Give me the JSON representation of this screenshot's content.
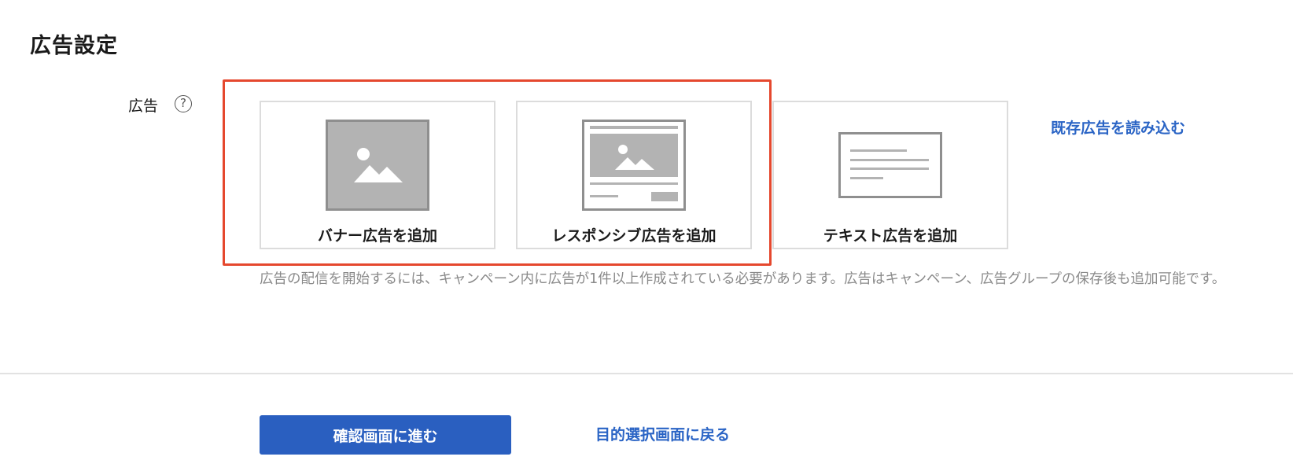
{
  "section": {
    "title": "広告設定"
  },
  "ad_field": {
    "label": "広告",
    "help_icon": "question-circle-icon",
    "help_glyph": "?"
  },
  "ad_cards": [
    {
      "label": "バナー広告を追加",
      "icon": "banner-image-icon"
    },
    {
      "label": "レスポンシブ広告を追加",
      "icon": "responsive-ad-icon"
    },
    {
      "label": "テキスト広告を追加",
      "icon": "text-ad-icon"
    }
  ],
  "load_existing_link": "既存広告を読み込む",
  "note": "広告の配信を開始するには、キャンペーン内に広告が1件以上作成されている必要があります。広告はキャンペーン、広告グループの保存後も追加可能です。",
  "footer": {
    "confirm_button": "確認画面に進む",
    "back_link": "目的選択画面に戻る"
  },
  "colors": {
    "accent": "#2a5fc0",
    "link": "#2a64c5",
    "highlight": "#e5482e",
    "placeholder_gray": "#b3b3b3"
  }
}
